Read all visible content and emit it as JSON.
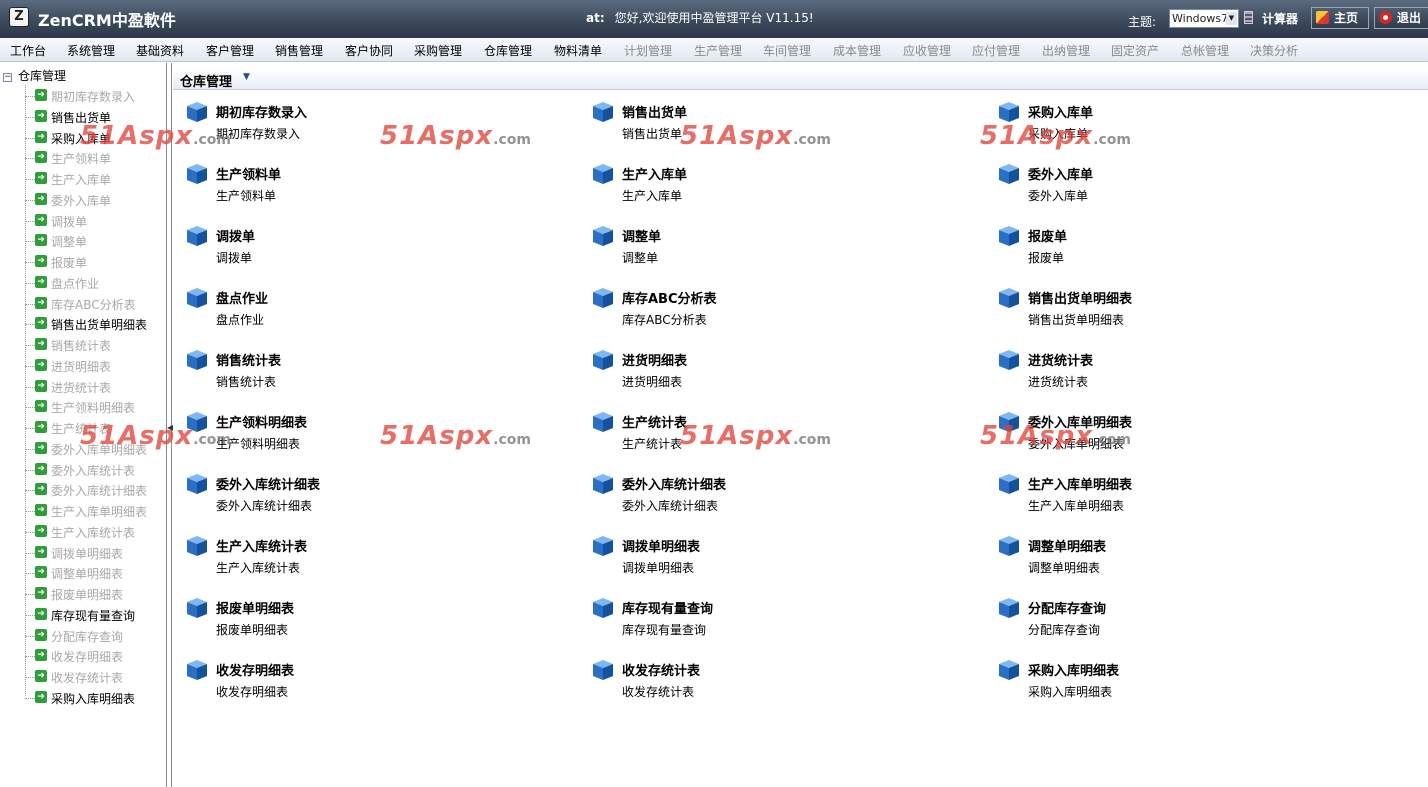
{
  "app": {
    "logo_glyph": "Z",
    "title": "ZenCRM中盈軟件"
  },
  "header": {
    "at_label": "at:",
    "welcome_text": "您好,欢迎使用中盈管理平台 V11.15!",
    "theme_label": "主题:",
    "theme_value": "Windows7",
    "calc_label": "计算器",
    "home_label": "主页",
    "exit_label": "退出"
  },
  "menu": [
    {
      "label": "工作台",
      "enabled": true
    },
    {
      "label": "系统管理",
      "enabled": true
    },
    {
      "label": "基础资料",
      "enabled": true
    },
    {
      "label": "客户管理",
      "enabled": true
    },
    {
      "label": "销售管理",
      "enabled": true
    },
    {
      "label": "客户协同",
      "enabled": true
    },
    {
      "label": "采购管理",
      "enabled": true
    },
    {
      "label": "仓库管理",
      "enabled": true
    },
    {
      "label": "物料清单",
      "enabled": true
    },
    {
      "label": "计划管理",
      "enabled": false
    },
    {
      "label": "生产管理",
      "enabled": false
    },
    {
      "label": "车间管理",
      "enabled": false
    },
    {
      "label": "成本管理",
      "enabled": false
    },
    {
      "label": "应收管理",
      "enabled": false
    },
    {
      "label": "应付管理",
      "enabled": false
    },
    {
      "label": "出纳管理",
      "enabled": false
    },
    {
      "label": "固定资产",
      "enabled": false
    },
    {
      "label": "总帐管理",
      "enabled": false
    },
    {
      "label": "决策分析",
      "enabled": false
    }
  ],
  "sidebar": {
    "root_label": "仓库管理",
    "items": [
      {
        "label": "期初库存数录入",
        "enabled": false
      },
      {
        "label": "销售出货单",
        "enabled": true
      },
      {
        "label": "采购入库单",
        "enabled": true
      },
      {
        "label": "生产领料单",
        "enabled": false
      },
      {
        "label": "生产入库单",
        "enabled": false
      },
      {
        "label": "委外入库单",
        "enabled": false
      },
      {
        "label": "调拨单",
        "enabled": false
      },
      {
        "label": "调整单",
        "enabled": false
      },
      {
        "label": "报废单",
        "enabled": false
      },
      {
        "label": "盘点作业",
        "enabled": false
      },
      {
        "label": "库存ABC分析表",
        "enabled": false
      },
      {
        "label": "销售出货单明细表",
        "enabled": true
      },
      {
        "label": "销售统计表",
        "enabled": false
      },
      {
        "label": "进货明细表",
        "enabled": false
      },
      {
        "label": "进货统计表",
        "enabled": false
      },
      {
        "label": "生产领料明细表",
        "enabled": false
      },
      {
        "label": "生产统计表",
        "enabled": false
      },
      {
        "label": "委外入库单明细表",
        "enabled": false
      },
      {
        "label": "委外入库统计表",
        "enabled": false
      },
      {
        "label": "委外入库统计细表",
        "enabled": false
      },
      {
        "label": "生产入库单明细表",
        "enabled": false
      },
      {
        "label": "生产入库统计表",
        "enabled": false
      },
      {
        "label": "调拨单明细表",
        "enabled": false
      },
      {
        "label": "调整单明细表",
        "enabled": false
      },
      {
        "label": "报废单明细表",
        "enabled": false
      },
      {
        "label": "库存现有量查询",
        "enabled": true
      },
      {
        "label": "分配库存查询",
        "enabled": false
      },
      {
        "label": "收发存明细表",
        "enabled": false
      },
      {
        "label": "收发存统计表",
        "enabled": false
      },
      {
        "label": "采购入库明细表",
        "enabled": true
      }
    ]
  },
  "content": {
    "title": "仓库管理",
    "dropdown_glyph": "▼",
    "cards": [
      {
        "title": "期初库存数录入",
        "subtitle": "期初库存数录入"
      },
      {
        "title": "销售出货单",
        "subtitle": "销售出货单"
      },
      {
        "title": "采购入库单",
        "subtitle": "采购入库单"
      },
      {
        "title": "生产领料单",
        "subtitle": "生产领料单"
      },
      {
        "title": "生产入库单",
        "subtitle": "生产入库单"
      },
      {
        "title": "委外入库单",
        "subtitle": "委外入库单"
      },
      {
        "title": "调拨单",
        "subtitle": "调拨单"
      },
      {
        "title": "调整单",
        "subtitle": "调整单"
      },
      {
        "title": "报废单",
        "subtitle": "报废单"
      },
      {
        "title": "盘点作业",
        "subtitle": "盘点作业"
      },
      {
        "title": "库存ABC分析表",
        "subtitle": "库存ABC分析表"
      },
      {
        "title": "销售出货单明细表",
        "subtitle": "销售出货单明细表"
      },
      {
        "title": "销售统计表",
        "subtitle": "销售统计表"
      },
      {
        "title": "进货明细表",
        "subtitle": "进货明细表"
      },
      {
        "title": "进货统计表",
        "subtitle": "进货统计表"
      },
      {
        "title": "生产领料明细表",
        "subtitle": "生产领料明细表"
      },
      {
        "title": "生产统计表",
        "subtitle": "生产统计表"
      },
      {
        "title": "委外入库单明细表",
        "subtitle": "委外入库单明细表"
      },
      {
        "title": "委外入库统计细表",
        "subtitle": "委外入库统计细表"
      },
      {
        "title": "委外入库统计细表",
        "subtitle": "委外入库统计细表"
      },
      {
        "title": "生产入库单明细表",
        "subtitle": "生产入库单明细表"
      },
      {
        "title": "生产入库统计表",
        "subtitle": "生产入库统计表"
      },
      {
        "title": "调拨单明细表",
        "subtitle": "调拨单明细表"
      },
      {
        "title": "调整单明细表",
        "subtitle": "调整单明细表"
      },
      {
        "title": "报废单明细表",
        "subtitle": "报废单明细表"
      },
      {
        "title": "库存现有量查询",
        "subtitle": "库存现有量查询"
      },
      {
        "title": "分配库存查询",
        "subtitle": "分配库存查询"
      },
      {
        "title": "收发存明细表",
        "subtitle": "收发存明细表"
      },
      {
        "title": "收发存统计表",
        "subtitle": "收发存统计表"
      },
      {
        "title": "采购入库明细表",
        "subtitle": "采购入库明细表"
      }
    ]
  },
  "watermark": {
    "big": "51Aspx",
    "small": ".com"
  },
  "colors": {
    "topbar": "#3c4a5c",
    "accent_blue": "#2a6fc4",
    "watermark_red": "#e0443c",
    "tree_icon_green": "#2f9e3a"
  }
}
